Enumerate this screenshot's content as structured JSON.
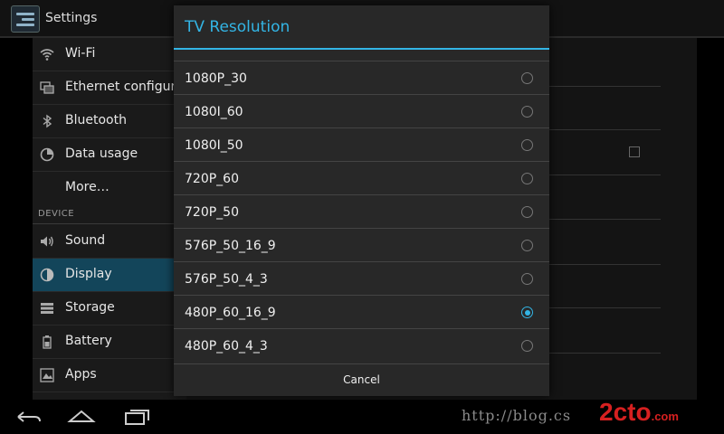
{
  "app": {
    "title": "Settings",
    "icon": "settings-sliders-icon"
  },
  "sidebar": {
    "items": [
      {
        "label": "Wi-Fi",
        "icon": "wifi-icon"
      },
      {
        "label": "Ethernet configurati",
        "icon": "ethernet-icon"
      },
      {
        "label": "Bluetooth",
        "icon": "bluetooth-icon"
      },
      {
        "label": "Data usage",
        "icon": "data-usage-icon"
      },
      {
        "label": "More…",
        "icon": ""
      }
    ],
    "device_header": "DEVICE",
    "device_items": [
      {
        "label": "Sound",
        "icon": "speaker-icon"
      },
      {
        "label": "Display",
        "icon": "display-brightness-icon",
        "active": true
      },
      {
        "label": "Storage",
        "icon": "storage-icon"
      },
      {
        "label": "Battery",
        "icon": "battery-icon"
      },
      {
        "label": "Apps",
        "icon": "apps-icon"
      }
    ]
  },
  "dialog": {
    "title": "TV Resolution",
    "options": [
      {
        "label": "1080P_30",
        "selected": false
      },
      {
        "label": "1080I_60",
        "selected": false
      },
      {
        "label": "1080I_50",
        "selected": false
      },
      {
        "label": "720P_60",
        "selected": false
      },
      {
        "label": "720P_50",
        "selected": false
      },
      {
        "label": "576P_50_16_9",
        "selected": false
      },
      {
        "label": "576P_50_4_3",
        "selected": false
      },
      {
        "label": "480P_60_16_9",
        "selected": true
      },
      {
        "label": "480P_60_4_3",
        "selected": false
      }
    ],
    "cancel_label": "Cancel"
  },
  "navbar": {
    "back_icon": "back-icon",
    "home_icon": "home-icon",
    "recents_icon": "recents-icon"
  },
  "watermark": {
    "url": "http://blog.cs",
    "logo": "2cto",
    "logo_suffix": ".com"
  },
  "colors": {
    "accent": "#33b5e5",
    "active_item": "#13455a",
    "dialog_bg": "#282828"
  }
}
